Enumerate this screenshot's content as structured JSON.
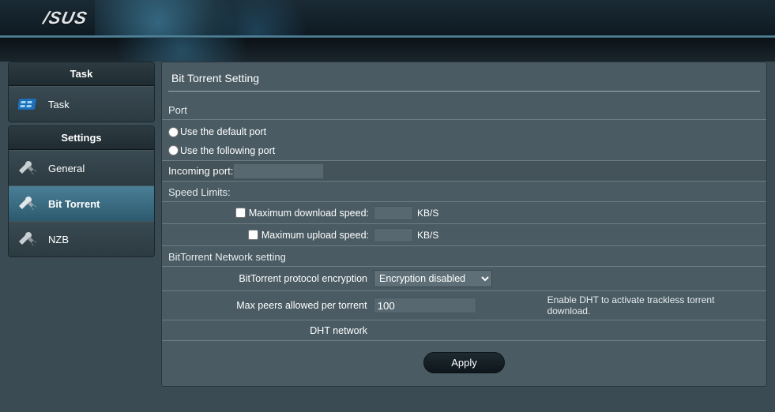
{
  "brand": "/SUS",
  "sidebar": {
    "task_header": "Task",
    "task_item": "Task",
    "settings_header": "Settings",
    "items": [
      {
        "label": "General"
      },
      {
        "label": "Bit Torrent"
      },
      {
        "label": "NZB"
      }
    ]
  },
  "content": {
    "title": "Bit Torrent Setting",
    "port": {
      "heading": "Port",
      "use_default": "Use the default port",
      "use_following": "Use the following port",
      "incoming_label": "Incoming port:",
      "incoming_value": ""
    },
    "speed": {
      "heading": "Speed Limits:",
      "max_dl_label": "Maximum download speed:",
      "max_ul_label": "Maximum upload speed:",
      "unit": "KB/S",
      "max_dl_value": "",
      "max_ul_value": ""
    },
    "network": {
      "heading": "BitTorrent Network setting",
      "encryption_label": "BitTorrent protocol encryption",
      "encryption_selected": "Encryption disabled",
      "max_peers_label": "Max peers allowed per torrent",
      "max_peers_value": "100",
      "dht_label": "DHT network",
      "dht_note": "Enable DHT to activate trackless torrent download."
    },
    "apply": "Apply"
  }
}
